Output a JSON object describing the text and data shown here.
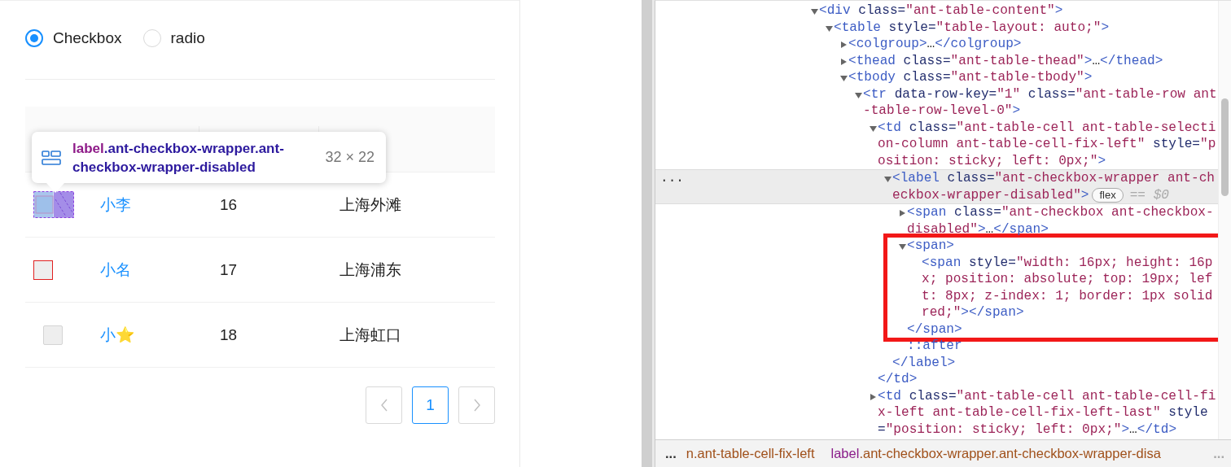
{
  "demo": {
    "radios": [
      {
        "label": "Checkbox",
        "selected": true
      },
      {
        "label": "radio",
        "selected": false
      }
    ],
    "table": {
      "rows": [
        {
          "checkbox": {
            "kind": "inspected",
            "disabled": true,
            "checked": false
          },
          "name": "小李",
          "age": "16",
          "address": "上海外滩"
        },
        {
          "checkbox": {
            "kind": "outlined",
            "disabled": true,
            "checked": false
          },
          "name": "小名",
          "age": "17",
          "address": "上海浦东"
        },
        {
          "checkbox": {
            "kind": "plain",
            "disabled": true,
            "checked": false
          },
          "name": "小⭐",
          "age": "18",
          "address": "上海虹口"
        }
      ]
    },
    "pagination": {
      "prev": {
        "disabled": true
      },
      "pages": [
        {
          "label": "1",
          "selected": true
        }
      ],
      "next": {
        "disabled": true
      }
    },
    "inspector_tooltip": {
      "tag": "label",
      "classes": ".ant-checkbox-wrapper.ant-checkbox-wrapper-disabled",
      "size": "32 × 22"
    }
  },
  "devtools": {
    "tree": [
      {
        "kind": "element",
        "expanded": true,
        "selected": false,
        "parts": [
          {
            "kind": "tag",
            "text": "<div"
          },
          {
            "kind": "attr",
            "text": " class="
          },
          {
            "kind": "value",
            "text": "\"ant-table-content\""
          },
          {
            "kind": "tag",
            "text": ">"
          }
        ],
        "children": [
          {
            "kind": "element",
            "expanded": true,
            "selected": false,
            "parts": [
              {
                "kind": "tag",
                "text": "<table"
              },
              {
                "kind": "attr",
                "text": " style="
              },
              {
                "kind": "value",
                "text": "\"table-layout: auto;\""
              },
              {
                "kind": "tag",
                "text": ">"
              }
            ],
            "children": [
              {
                "kind": "element",
                "expanded": false,
                "selected": false,
                "parts": [
                  {
                    "kind": "tag",
                    "text": "<colgroup>"
                  },
                  {
                    "kind": "text",
                    "text": "…"
                  },
                  {
                    "kind": "tag",
                    "text": "</colgroup>"
                  }
                ]
              },
              {
                "kind": "element",
                "expanded": false,
                "selected": false,
                "parts": [
                  {
                    "kind": "tag",
                    "text": "<thead"
                  },
                  {
                    "kind": "attr",
                    "text": " class="
                  },
                  {
                    "kind": "value",
                    "text": "\"ant-table-thead\""
                  },
                  {
                    "kind": "tag",
                    "text": ">"
                  },
                  {
                    "kind": "text",
                    "text": "…"
                  },
                  {
                    "kind": "tag",
                    "text": "</thead>"
                  }
                ]
              },
              {
                "kind": "element",
                "expanded": true,
                "selected": false,
                "parts": [
                  {
                    "kind": "tag",
                    "text": "<tbody"
                  },
                  {
                    "kind": "attr",
                    "text": " class="
                  },
                  {
                    "kind": "value",
                    "text": "\"ant-table-tbody\""
                  },
                  {
                    "kind": "tag",
                    "text": ">"
                  }
                ],
                "children": [
                  {
                    "kind": "element",
                    "expanded": true,
                    "selected": false,
                    "parts": [
                      {
                        "kind": "tag",
                        "text": "<tr"
                      },
                      {
                        "kind": "attr",
                        "text": " data-row-key="
                      },
                      {
                        "kind": "value",
                        "text": "\"1\""
                      },
                      {
                        "kind": "attr",
                        "text": " class="
                      },
                      {
                        "kind": "value",
                        "text": "\"ant-table-row ant-table-row-level-0\""
                      },
                      {
                        "kind": "tag",
                        "text": ">"
                      }
                    ],
                    "children": [
                      {
                        "kind": "element",
                        "expanded": true,
                        "selected": false,
                        "close": "</td>",
                        "parts": [
                          {
                            "kind": "tag",
                            "text": "<td"
                          },
                          {
                            "kind": "attr",
                            "text": " class="
                          },
                          {
                            "kind": "value",
                            "text": "\"ant-table-cell ant-table-selection-column ant-table-cell-fix-left\""
                          },
                          {
                            "kind": "attr",
                            "text": " style="
                          },
                          {
                            "kind": "value",
                            "text": "\"position: sticky; left: 0px;\""
                          },
                          {
                            "kind": "tag",
                            "text": ">"
                          }
                        ],
                        "children": [
                          {
                            "kind": "element",
                            "expanded": true,
                            "selected": true,
                            "more": "...",
                            "badge": "flex",
                            "hint": "== $0",
                            "close": "</label>",
                            "parts": [
                              {
                                "kind": "tag",
                                "text": "<label"
                              },
                              {
                                "kind": "attr",
                                "text": " class="
                              },
                              {
                                "kind": "value",
                                "text": "\"ant-checkbox-wrapper ant-checkbox-wrapper-disabled\""
                              },
                              {
                                "kind": "tag",
                                "text": ">"
                              }
                            ],
                            "children": [
                              {
                                "kind": "element",
                                "expanded": false,
                                "selected": false,
                                "parts": [
                                  {
                                    "kind": "tag",
                                    "text": "<span"
                                  },
                                  {
                                    "kind": "attr",
                                    "text": " class="
                                  },
                                  {
                                    "kind": "value",
                                    "text": "\"ant-checkbox ant-checkbox-disabled\""
                                  },
                                  {
                                    "kind": "tag",
                                    "text": ">"
                                  },
                                  {
                                    "kind": "text",
                                    "text": "…"
                                  },
                                  {
                                    "kind": "tag",
                                    "text": "</span>"
                                  }
                                ]
                              },
                              {
                                "kind": "element",
                                "expanded": true,
                                "selected": false,
                                "boxed": true,
                                "close": "</span>",
                                "parts": [
                                  {
                                    "kind": "tag",
                                    "text": "<span>"
                                  }
                                ],
                                "children": [
                                  {
                                    "kind": "leaf",
                                    "parts": [
                                      {
                                        "kind": "tag",
                                        "text": "<span"
                                      },
                                      {
                                        "kind": "attr",
                                        "text": " style="
                                      },
                                      {
                                        "kind": "value",
                                        "text": "\"width: 16px; height: 16px; position: absolute; top: 19px; left: 8px; z-index: 1; border: 1px solid red;\""
                                      },
                                      {
                                        "kind": "tag",
                                        "text": ">"
                                      },
                                      {
                                        "kind": "tag",
                                        "text": "</span>"
                                      }
                                    ]
                                  }
                                ]
                              },
                              {
                                "kind": "leaf",
                                "parts": [
                                  {
                                    "kind": "tag",
                                    "text": "::after"
                                  }
                                ]
                              }
                            ]
                          }
                        ]
                      },
                      {
                        "kind": "element",
                        "expanded": false,
                        "selected": false,
                        "parts": [
                          {
                            "kind": "tag",
                            "text": "<td"
                          },
                          {
                            "kind": "attr",
                            "text": " class="
                          },
                          {
                            "kind": "value",
                            "text": "\"ant-table-cell ant-table-cell-fix-left ant-table-cell-fix-left-last\""
                          },
                          {
                            "kind": "attr",
                            "text": " style="
                          },
                          {
                            "kind": "value",
                            "text": "\"position: sticky; left: 0px;\""
                          },
                          {
                            "kind": "tag",
                            "text": ">"
                          },
                          {
                            "kind": "text",
                            "text": "…"
                          },
                          {
                            "kind": "tag",
                            "text": "</td>"
                          }
                        ]
                      }
                    ]
                  }
                ]
              }
            ]
          }
        ]
      }
    ],
    "breadcrumb": {
      "more_left": "...",
      "items": [
        {
          "classes": "n.ant-table-cell-fix-left",
          "selected": false
        },
        {
          "tag": "label",
          "classes": ".ant-checkbox-wrapper.ant-checkbox-wrapper-disa",
          "selected": true
        }
      ],
      "more_right": "..."
    }
  }
}
